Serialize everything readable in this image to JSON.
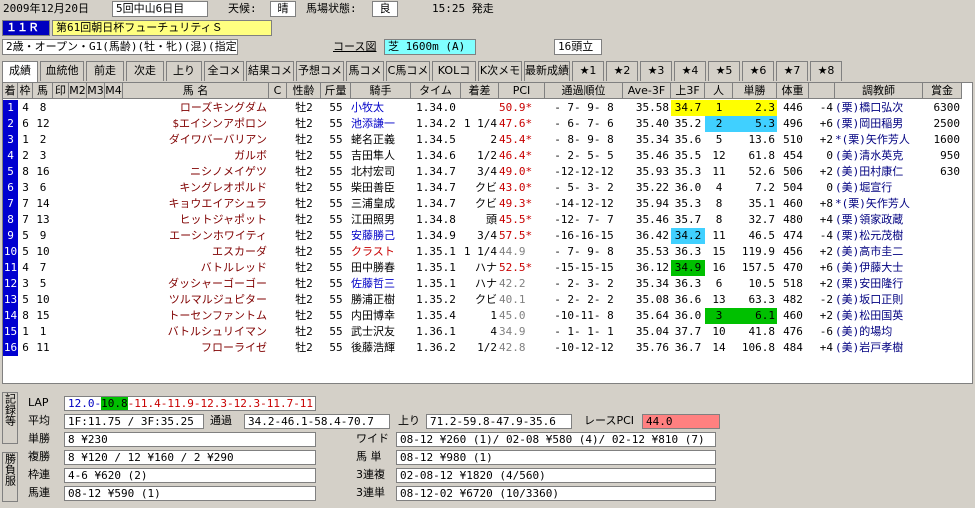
{
  "header": {
    "date": "2009年12月20日",
    "kai": "5回中山6日目",
    "weather_label": "天候:",
    "weather": "晴",
    "track_label": "馬場状態:",
    "track": "良",
    "post_time": "15:25 発走",
    "race_no": "１１Ｒ",
    "race_name": "第61回朝日杯フューチュリティＳ",
    "conditions": "2歳・オープン・G1(馬齢)(牡・牝)(混)(指定)",
    "course_btn": "コース図",
    "course": "芝 1600m (A)",
    "heads": "16頭立"
  },
  "tabs": [
    "成績",
    "血統他",
    "前走",
    "次走",
    "上り",
    "全コメ",
    "結果コメ",
    "予想コメ",
    "馬コメ",
    "C馬コメ",
    "KOLコメ",
    "K次メモ",
    "最新成績",
    "★1",
    "★2",
    "★3",
    "★4",
    "★5",
    "★6",
    "★7",
    "★8"
  ],
  "columns": [
    "着",
    "枠",
    "馬",
    "印",
    "M2",
    "M3",
    "M4",
    "馬 名",
    "C",
    "性齢",
    "斤量",
    "騎手",
    "タイム",
    "着差",
    "PCI",
    "通過順位",
    "Ave-3F",
    "上3F",
    "人",
    "単勝",
    "体重",
    "",
    "調教師",
    "賞金"
  ],
  "rows": [
    [
      "1",
      "4",
      "8",
      "",
      "",
      "",
      "",
      "ローズキングダム",
      "",
      "牡2",
      "55",
      "小牧太",
      "1.34.0",
      "",
      "50.9*",
      "- 7- 9- 8",
      "35.58",
      "34.7",
      "1",
      "2.3",
      "446",
      "-4",
      "(栗)橋口弘次",
      "6300"
    ],
    [
      "2",
      "6",
      "12",
      "",
      "",
      "",
      "",
      "$エイシンアポロン",
      "",
      "牡2",
      "55",
      "池添謙一",
      "1.34.2",
      "1 1/4",
      "47.6*",
      "- 6- 7- 6",
      "35.40",
      "35.2",
      "2",
      "5.3",
      "496",
      "+6",
      "(栗)岡田稲男",
      "2500"
    ],
    [
      "3",
      "1",
      "2",
      "",
      "",
      "",
      "",
      "ダイワバーバリアン",
      "",
      "牡2",
      "55",
      "蛯名正義",
      "1.34.5",
      "2",
      "45.4*",
      "- 8- 9- 8",
      "35.34",
      "35.6",
      "5",
      "13.6",
      "510",
      "+2",
      "*(栗)矢作芳人",
      "1600"
    ],
    [
      "4",
      "2",
      "3",
      "",
      "",
      "",
      "",
      "ガルボ",
      "",
      "牡2",
      "55",
      "吉田隼人",
      "1.34.6",
      "1/2",
      "46.4*",
      "- 2- 5- 5",
      "35.46",
      "35.5",
      "12",
      "61.8",
      "454",
      "0",
      "(美)清水英克",
      "950"
    ],
    [
      "5",
      "8",
      "16",
      "",
      "",
      "",
      "",
      "ニシノメイゲツ",
      "",
      "牡2",
      "55",
      "北村宏司",
      "1.34.7",
      "3/4",
      "49.0*",
      "-12-12-12",
      "35.93",
      "35.3",
      "11",
      "52.6",
      "506",
      "+2",
      "(美)田村康仁",
      "630"
    ],
    [
      "6",
      "3",
      "6",
      "",
      "",
      "",
      "",
      "キングレオポルド",
      "",
      "牡2",
      "55",
      "柴田善臣",
      "1.34.7",
      "クビ",
      "43.0*",
      "- 5- 3- 2",
      "35.22",
      "36.0",
      "4",
      "7.2",
      "504",
      "0",
      "(美)堀宣行",
      ""
    ],
    [
      "7",
      "7",
      "14",
      "",
      "",
      "",
      "",
      "キョウエイアシュラ",
      "",
      "牡2",
      "55",
      "三浦皇成",
      "1.34.7",
      "クビ",
      "49.3*",
      "-14-12-12",
      "35.94",
      "35.3",
      "8",
      "35.1",
      "460",
      "+8",
      "*(栗)矢作芳人",
      ""
    ],
    [
      "8",
      "7",
      "13",
      "",
      "",
      "",
      "",
      "ヒットジャポット",
      "",
      "牡2",
      "55",
      "江田照男",
      "1.34.8",
      "頭",
      "45.5*",
      "-12- 7- 7",
      "35.46",
      "35.7",
      "8",
      "32.7",
      "480",
      "+4",
      "(栗)領家政蔵",
      ""
    ],
    [
      "9",
      "5",
      "9",
      "",
      "",
      "",
      "",
      "エーシンホワイティ",
      "",
      "牡2",
      "55",
      "安藤勝己",
      "1.34.9",
      "3/4",
      "57.5*",
      "-16-16-15",
      "36.42",
      "34.2",
      "11",
      "46.5",
      "474",
      "-4",
      "(栗)松元茂樹",
      ""
    ],
    [
      "10",
      "5",
      "10",
      "",
      "",
      "",
      "",
      "エスカーダ",
      "",
      "牡2",
      "55",
      "クラスト",
      "1.35.1",
      "1 1/4",
      "44.9",
      "- 7- 9- 8",
      "35.53",
      "36.3",
      "15",
      "119.9",
      "456",
      "+2",
      "(美)高市圭二",
      ""
    ],
    [
      "11",
      "4",
      "7",
      "",
      "",
      "",
      "",
      "バトルレッド",
      "",
      "牡2",
      "55",
      "田中勝春",
      "1.35.1",
      "ハナ",
      "52.5*",
      "-15-15-15",
      "36.12",
      "34.9",
      "16",
      "157.5",
      "470",
      "+6",
      "(美)伊藤大士",
      ""
    ],
    [
      "12",
      "3",
      "5",
      "",
      "",
      "",
      "",
      "ダッシャーゴーゴー",
      "",
      "牡2",
      "55",
      "佐藤哲三",
      "1.35.1",
      "ハナ",
      "42.2",
      "- 2- 3- 2",
      "35.34",
      "36.3",
      "6",
      "10.5",
      "518",
      "+2",
      "(栗)安田隆行",
      ""
    ],
    [
      "13",
      "5",
      "10",
      "",
      "",
      "",
      "",
      "ツルマルジュピター",
      "",
      "牡2",
      "55",
      "勝浦正樹",
      "1.35.2",
      "クビ",
      "40.1",
      "- 2- 2- 2",
      "35.08",
      "36.6",
      "13",
      "63.3",
      "482",
      "-2",
      "(美)坂口正則",
      ""
    ],
    [
      "14",
      "8",
      "15",
      "",
      "",
      "",
      "",
      "トーセンファントム",
      "",
      "牡2",
      "55",
      "内田博幸",
      "1.35.4",
      "1",
      "45.0",
      "-10-11- 8",
      "35.64",
      "36.0",
      "3",
      "6.1",
      "460",
      "+2",
      "(美)松田国英",
      ""
    ],
    [
      "15",
      "1",
      "1",
      "",
      "",
      "",
      "",
      "バトルシュリイマン",
      "",
      "牡2",
      "55",
      "武士沢友",
      "1.36.1",
      "4",
      "34.9",
      "- 1- 1- 1",
      "35.04",
      "37.7",
      "10",
      "41.8",
      "476",
      "-6",
      "(美)的場均",
      ""
    ],
    [
      "16",
      "6",
      "11",
      "",
      "",
      "",
      "",
      "フローライゼ",
      "",
      "牡2",
      "55",
      "後藤浩輝",
      "1.36.2",
      "1/2",
      "42.8",
      "-10-12-12",
      "35.76",
      "36.7",
      "14",
      "106.8",
      "484",
      "+4",
      "(美)岩戸孝樹",
      ""
    ]
  ],
  "side": {
    "top": "記録等",
    "bottom": "勝負服"
  },
  "summary": {
    "lap_label": "LAP",
    "lap_pre": "12.0-",
    "lap_hl": "10.8",
    "lap_post": "-11.4-11.9-12.3-12.3-11.7-11.6",
    "avg_label": "平均",
    "avg": "1F:11.75 / 3F:35.25",
    "pass_label": "通過",
    "pass": "34.2-46.1-58.4-70.7",
    "up_label": "上り",
    "up": "71.2-59.8-47.9-35.6",
    "pci_label": "レースPCI",
    "pci": "44.0",
    "tansho_label": "単勝",
    "tansho": "8 ¥230",
    "fukusho_label": "複勝",
    "fukusho": "8 ¥120 / 12 ¥160 / 2 ¥290",
    "wakuren_label": "枠連",
    "wakuren": "4-6 ¥620 (2)",
    "umaren_label": "馬連",
    "umaren": "08-12 ¥590 (1)",
    "wide_label": "ワイド",
    "wide": "08-12 ¥260 (1)/ 02-08 ¥580 (4)/ 02-12 ¥810 (7)",
    "umatan_label": "馬 単",
    "umatan": "08-12 ¥980 (1)",
    "sanrenpuku_label": "3連複",
    "sanrenpuku": "02-08-12 ¥1820 (4/560)",
    "sanrentan_label": "3連単",
    "sanrentan": "08-12-02 ¥6720 (10/3360)"
  },
  "colors": {
    "waku": [
      "#ffffff",
      "#000000",
      "#ff3030",
      "#0040ff",
      "#ffff00",
      "#00a000",
      "#ff8000",
      "#ff80c0"
    ],
    "rank_bg": "#0000d0",
    "rank_fg": "#ffffff",
    "up3_best": "#40d0ff",
    "up3_second": "#ffff00",
    "up3_third": "#00c000",
    "pop1": "#ffff00",
    "pop2": "#40d0ff",
    "pop3": "#00c000",
    "race_no_bg": "#0000c0",
    "race_name_bg": "#ffff80",
    "course_bg": "#80ffff",
    "pci_bg": "#ff8080",
    "lap_hl_bg": "#00c000"
  }
}
